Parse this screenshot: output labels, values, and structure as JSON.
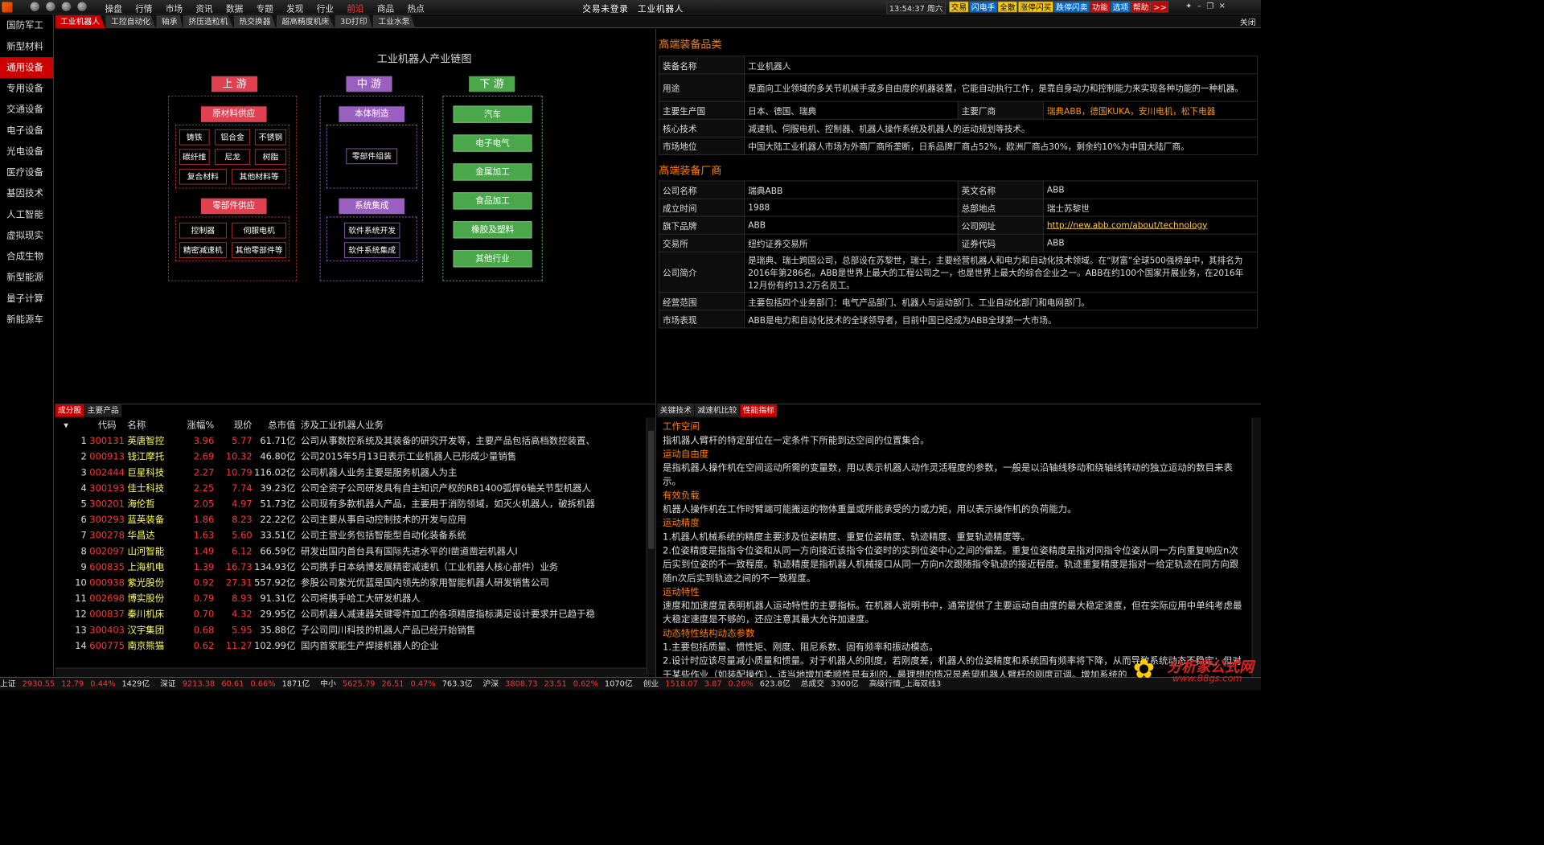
{
  "menu": [
    "操盘",
    "行情",
    "市场",
    "资讯",
    "数据",
    "专题",
    "发现",
    "行业",
    "前沿",
    "商品",
    "热点"
  ],
  "title": {
    "login": "交易未登录",
    "name": "工业机器人"
  },
  "clock": "13:54:37 周六",
  "toolbuttons": [
    "交易",
    "闪电手",
    "全散",
    "涨停闪买",
    "跌停闪卖",
    "功能",
    "选项",
    "帮助",
    ">>"
  ],
  "sidebar": [
    "国防军工",
    "新型材料",
    "通用设备",
    "专用设备",
    "交通设备",
    "电子设备",
    "光电设备",
    "医疗设备",
    "基因技术",
    "人工智能",
    "虚拟现实",
    "合成生物",
    "新型能源",
    "量子计算",
    "新能源车"
  ],
  "tabs": [
    "工业机器人",
    "工控自动化",
    "轴承",
    "挤压造粒机",
    "热交换器",
    "超高精度机床",
    "3D打印",
    "工业水泵"
  ],
  "close_all": "关闭",
  "chain": {
    "title": "工业机器人产业链图",
    "up": "上 游",
    "mid": "中 游",
    "down": "下 游",
    "raw": "原材料供应",
    "raw_items": [
      "铸铁",
      "铝合金",
      "不锈钢",
      "碳纤维",
      "尼龙",
      "树脂",
      "复合材料",
      "其他材料等"
    ],
    "parts": "零部件供应",
    "parts_items": [
      "控制器",
      "伺服电机",
      "精密减速机",
      "其他零部件等"
    ],
    "body": "本体制造",
    "body_items": [
      "零部件组装"
    ],
    "integ": "系统集成",
    "integ_items": [
      "软件系统开发",
      "软件系统集成"
    ],
    "down_items": [
      "汽车",
      "电子电气",
      "金属加工",
      "食品加工",
      "橡胶及塑料",
      "其他行业"
    ]
  },
  "equip": {
    "section": "高端装备品类",
    "rows": [
      {
        "k": "装备名称",
        "v": "工业机器人"
      },
      {
        "k": "用途",
        "v": "是面向工业领域的多关节机械手或多自由度的机器装置，它能自动执行工作，是靠自身动力和控制能力来实现各种功能的一种机器。"
      },
      {
        "k": "主要生产国",
        "v": "日本、德国、瑞典",
        "k2": "主要厂商",
        "v2": "瑞典ABB，德国KUKA，安川电机，松下电器"
      },
      {
        "k": "核心技术",
        "v": "减速机、伺服电机、控制器、机器人操作系统及机器人的运动规划等技术。"
      },
      {
        "k": "市场地位",
        "v": "中国大陆工业机器人市场为外商厂商所垄断，日系品牌厂商占52%，欧洲厂商占30%，剩余约10%为中国大陆厂商。"
      }
    ]
  },
  "maker": {
    "section": "高端装备厂商",
    "name_k": "公司名称",
    "name_v": "瑞典ABB",
    "en_k": "英文名称",
    "en_v": "ABB",
    "year_k": "成立时间",
    "year_v": "1988",
    "hq_k": "总部地点",
    "hq_v": "瑞士苏黎世",
    "brand_k": "旗下品牌",
    "brand_v": "ABB",
    "url_k": "公司网址",
    "url_v": "http://new.abb.com/about/technology",
    "ex_k": "交易所",
    "ex_v": "纽约证券交易所",
    "code_k": "证券代码",
    "code_v": "ABB",
    "intro_k": "公司简介",
    "intro_v": "是瑞典、瑞士跨国公司，总部设在苏黎世，瑞士，主要经营机器人和电力和自动化技术领域。在“财富”全球500强榜单中，其排名为2016年第286名。ABB是世界上最大的工程公司之一，也是世界上最大的综合企业之一。ABB在约100个国家开展业务，在2016年12月份有约13.2万名员工。",
    "scope_k": "经营范围",
    "scope_v": "主要包括四个业务部门：电气产品部门、机器人与运动部门、工业自动化部门和电网部门。",
    "perf_k": "市场表现",
    "perf_v": "ABB是电力和自动化技术的全球领导者，目前中国已经成为ABB全球第一大市场。"
  },
  "stocks": {
    "tabs": [
      "成分股",
      "主要产品"
    ],
    "head": [
      "代码",
      "名称",
      "涨幅%",
      "现价",
      "总市值",
      "涉及工业机器人业务"
    ],
    "rows": [
      [
        "1",
        "300131",
        "英唐智控",
        "3.96",
        "5.77",
        "61.71亿",
        "公司从事数控系统及其装备的研究开发等，主要产品包括高档数控装置、"
      ],
      [
        "2",
        "000913",
        "钱江摩托",
        "2.69",
        "10.32",
        "46.80亿",
        "公司2015年5月13日表示工业机器人已形成少量销售"
      ],
      [
        "3",
        "002444",
        "巨星科技",
        "2.27",
        "10.79",
        "116.02亿",
        "公司机器人业务主要是服务机器人为主"
      ],
      [
        "4",
        "300193",
        "佳士科技",
        "2.25",
        "7.74",
        "39.23亿",
        "公司全资子公司研发具有自主知识产权的RB1400弧焊6轴关节型机器人"
      ],
      [
        "5",
        "300201",
        "海伦哲",
        "2.05",
        "4.97",
        "51.73亿",
        "公司现有多款机器人产品，主要用于消防领域，如灭火机器人，破拆机器"
      ],
      [
        "6",
        "300293",
        "蓝英装备",
        "1.86",
        "8.23",
        "22.22亿",
        "公司主要从事自动控制技术的开发与应用"
      ],
      [
        "7",
        "300278",
        "华昌达",
        "1.63",
        "5.60",
        "33.51亿",
        "公司主营业务包括智能型自动化装备系统"
      ],
      [
        "8",
        "002097",
        "山河智能",
        "1.49",
        "6.12",
        "66.59亿",
        "研发出国内首台具有国际先进水平的Ⅰ凿道凿岩机器人Ⅰ"
      ],
      [
        "9",
        "600835",
        "上海机电",
        "1.39",
        "16.73",
        "134.93亿",
        "公司携手日本纳博发展精密减速机（工业机器人核心部件）业务"
      ],
      [
        "10",
        "000938",
        "紫光股份",
        "0.92",
        "27.31",
        "557.92亿",
        "参股公司紫光优蓝是国内领先的家用智能机器人研发销售公司"
      ],
      [
        "11",
        "002698",
        "博实股份",
        "0.79",
        "8.93",
        "91.31亿",
        "公司将携手哈工大研发机器人"
      ],
      [
        "12",
        "000837",
        "秦川机床",
        "0.70",
        "4.32",
        "29.95亿",
        "公司机器人减速器关键零件加工的各项精度指标满足设计要求并已趋于稳"
      ],
      [
        "13",
        "300403",
        "汉宇集团",
        "0.68",
        "5.95",
        "35.88亿",
        "子公司同川科技的机器人产品已经开始销售"
      ],
      [
        "14",
        "600775",
        "南京熊猫",
        "0.62",
        "11.27",
        "102.99亿",
        "国内首家能生产焊接机器人的企业"
      ]
    ]
  },
  "specs": {
    "tabs": [
      "关键技术",
      "减速机比较",
      "性能指标"
    ],
    "items": [
      {
        "h": "工作空间",
        "t": "指机器人臂杆的特定部位在一定条件下所能到达空间的位置集合。"
      },
      {
        "h": "运动自由度",
        "t": "是指机器人操作机在空间运动所需的变量数，用以表示机器人动作灵活程度的参数，一般是以沿轴线移动和绕轴线转动的独立运动的数目来表示。"
      },
      {
        "h": "有效负载",
        "t": "机器人操作机在工作时臂端可能搬运的物体重量或所能承受的力或力矩，用以表示操作机的负荷能力。"
      },
      {
        "h": "运动精度",
        "t": "1.机器人机械系统的精度主要涉及位姿精度、重复位姿精度、轨迹精度、重复轨迹精度等。\n2.位姿精度是指指令位姿和从同一方向接近该指令位姿时的实到位姿中心之间的偏差。重复位姿精度是指对同指令位姿从同一方向重复响应n次后实到位姿的不一致程度。轨迹精度是指机器人机械接口从同一方向n次跟随指令轨迹的接近程度。轨迹重复精度是指对一给定轨迹在同方向跟随n次后实到轨迹之间的不一致程度。"
      },
      {
        "h": "运动特性",
        "t": "速度和加速度是表明机器人运动特性的主要指标。在机器人说明书中，通常提供了主要运动自由度的最大稳定速度，但在实际应用中单纯考虑最大稳定速度是不够的，还应注意其最大允许加速度。"
      },
      {
        "h": "动态特性结构动态参数",
        "t": "1.主要包括质量、惯性矩、刚度、阻尼系数、固有频率和振动模态。\n2.设计时应该尽量减小质量和惯量。对于机器人的刚度，若刚度差，机器人的位姿精度和系统固有频率将下降，从而导致系统动态不稳定；但对于某些作业（如装配操作），适当地增加柔顺性是有利的，最理想的情况是希望机器人臂杆的刚度可调。增加系统的"
      }
    ]
  },
  "status": {
    "sh": {
      "n": "上证",
      "v": "2930.55",
      "c": "12.79",
      "p": "0.44%",
      "a": "1429亿"
    },
    "sz": {
      "n": "深证",
      "v": "9213.38",
      "c": "60.61",
      "p": "0.66%",
      "a": "1871亿"
    },
    "zx": {
      "n": "中小",
      "v": "5625.79",
      "c": "26.51",
      "p": "0.47%",
      "a": "763.3亿"
    },
    "hs": {
      "n": "沪深",
      "v": "3808.73",
      "c": "23.51",
      "p": "0.62%",
      "a": "1070亿"
    },
    "cy": {
      "n": "创业",
      "v": "1518.07",
      "c": "3.87",
      "p": "0.26%",
      "a": "623.8亿"
    },
    "total_k": "总成交",
    "total_v": "3300亿",
    "server": "高级行情_上海双线3"
  },
  "watermark": {
    "t1": "分析家公式网",
    "t2": "www.88gs.com"
  },
  "colors": {
    "accent": "#cc0000",
    "orange": "#ff8000",
    "up": "#ff3333",
    "gold": "#ffcc00"
  }
}
